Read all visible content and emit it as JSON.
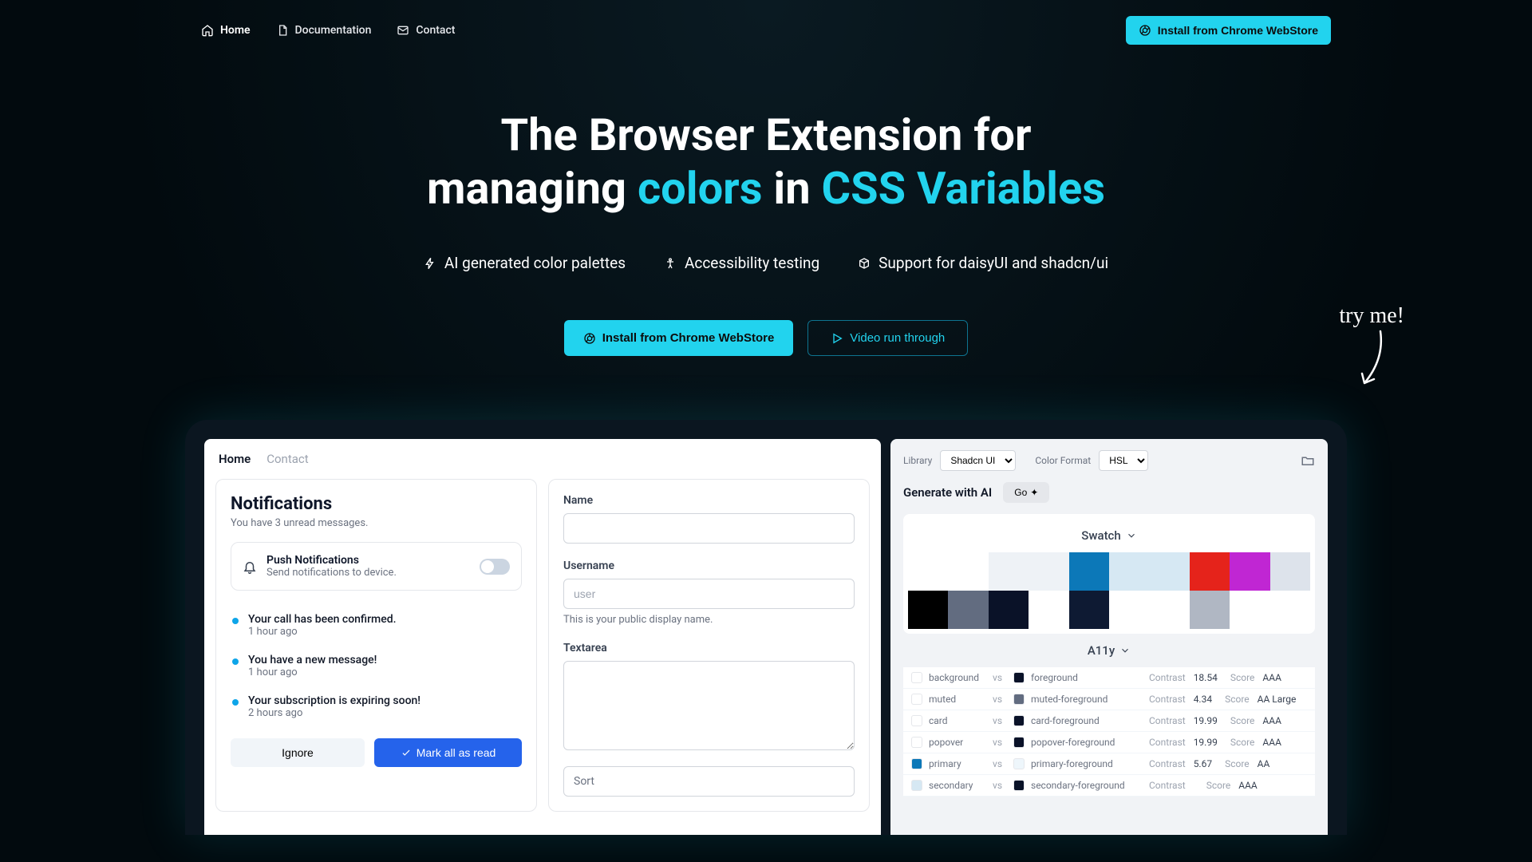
{
  "nav": {
    "home": "Home",
    "docs": "Documentation",
    "contact": "Contact",
    "install": "Install from Chrome WebStore"
  },
  "hero": {
    "line1a": "The Browser Extension for",
    "line2a": "managing ",
    "line2b": "colors",
    "line2c": " in ",
    "line2d": "CSS Variables",
    "feat1": "AI generated color palettes",
    "feat2": "Accessibility testing",
    "feat3": "Support for daisyUI and shadcn/ui",
    "btn_install": "Install from Chrome WebStore",
    "btn_video": "Video run through",
    "tryme": "try me!"
  },
  "mock": {
    "tab_home": "Home",
    "tab_contact": "Contact",
    "notif": {
      "title": "Notifications",
      "sub": "You have 3 unread messages.",
      "push_title": "Push Notifications",
      "push_sub": "Send notifications to device.",
      "items": [
        {
          "t": "Your call has been confirmed.",
          "s": "1 hour ago"
        },
        {
          "t": "You have a new message!",
          "s": "1 hour ago"
        },
        {
          "t": "Your subscription is expiring soon!",
          "s": "2 hours ago"
        }
      ],
      "ignore": "Ignore",
      "mark": "Mark all as read"
    },
    "form": {
      "name_label": "Name",
      "user_label": "Username",
      "user_placeholder": "user",
      "user_helper": "This is your public display name.",
      "textarea_label": "Textarea",
      "sort_label": "Sort"
    },
    "right": {
      "library_label": "Library",
      "library_val": "Shadcn UI",
      "format_label": "Color Format",
      "format_val": "HSL",
      "gen_title": "Generate with AI",
      "go": "Go",
      "swatch_title": "Swatch",
      "a11y_title": "A11y",
      "swatches": [
        "#ffffff",
        "#ffffff",
        "#eef2f6",
        "#eef2f6",
        "#0c78b8",
        "#d6e8f3",
        "#d6e8f3",
        "#e5231b",
        "#c026d3",
        "#dde3eb",
        "#000000",
        "#626c80",
        "#0a1228",
        "#ffffff",
        "#0e1a33",
        "#ffffff",
        "#ffffff",
        "#b0b7c3",
        "",
        ""
      ],
      "a11y": [
        {
          "bg": "#ffffff",
          "bn": "background",
          "fg": "#0a1228",
          "fn": "foreground",
          "c": "18.54",
          "s": "AAA"
        },
        {
          "bg": "#ffffff",
          "bn": "muted",
          "fg": "#626c80",
          "fn": "muted-foreground",
          "c": "4.34",
          "s": "AA Large"
        },
        {
          "bg": "#ffffff",
          "bn": "card",
          "fg": "#0a1228",
          "fn": "card-foreground",
          "c": "19.99",
          "s": "AAA"
        },
        {
          "bg": "#ffffff",
          "bn": "popover",
          "fg": "#0a1228",
          "fn": "popover-foreground",
          "c": "19.99",
          "s": "AAA"
        },
        {
          "bg": "#0c78b8",
          "bn": "primary",
          "fg": "#eef6fb",
          "fn": "primary-foreground",
          "c": "5.67",
          "s": "AA"
        },
        {
          "bg": "#d6e8f3",
          "bn": "secondary",
          "fg": "#0a1228",
          "fn": "secondary-foreground",
          "c": "",
          "s": "AAA"
        }
      ],
      "contrast_label": "Contrast",
      "score_label": "Score",
      "vs": "vs"
    }
  }
}
